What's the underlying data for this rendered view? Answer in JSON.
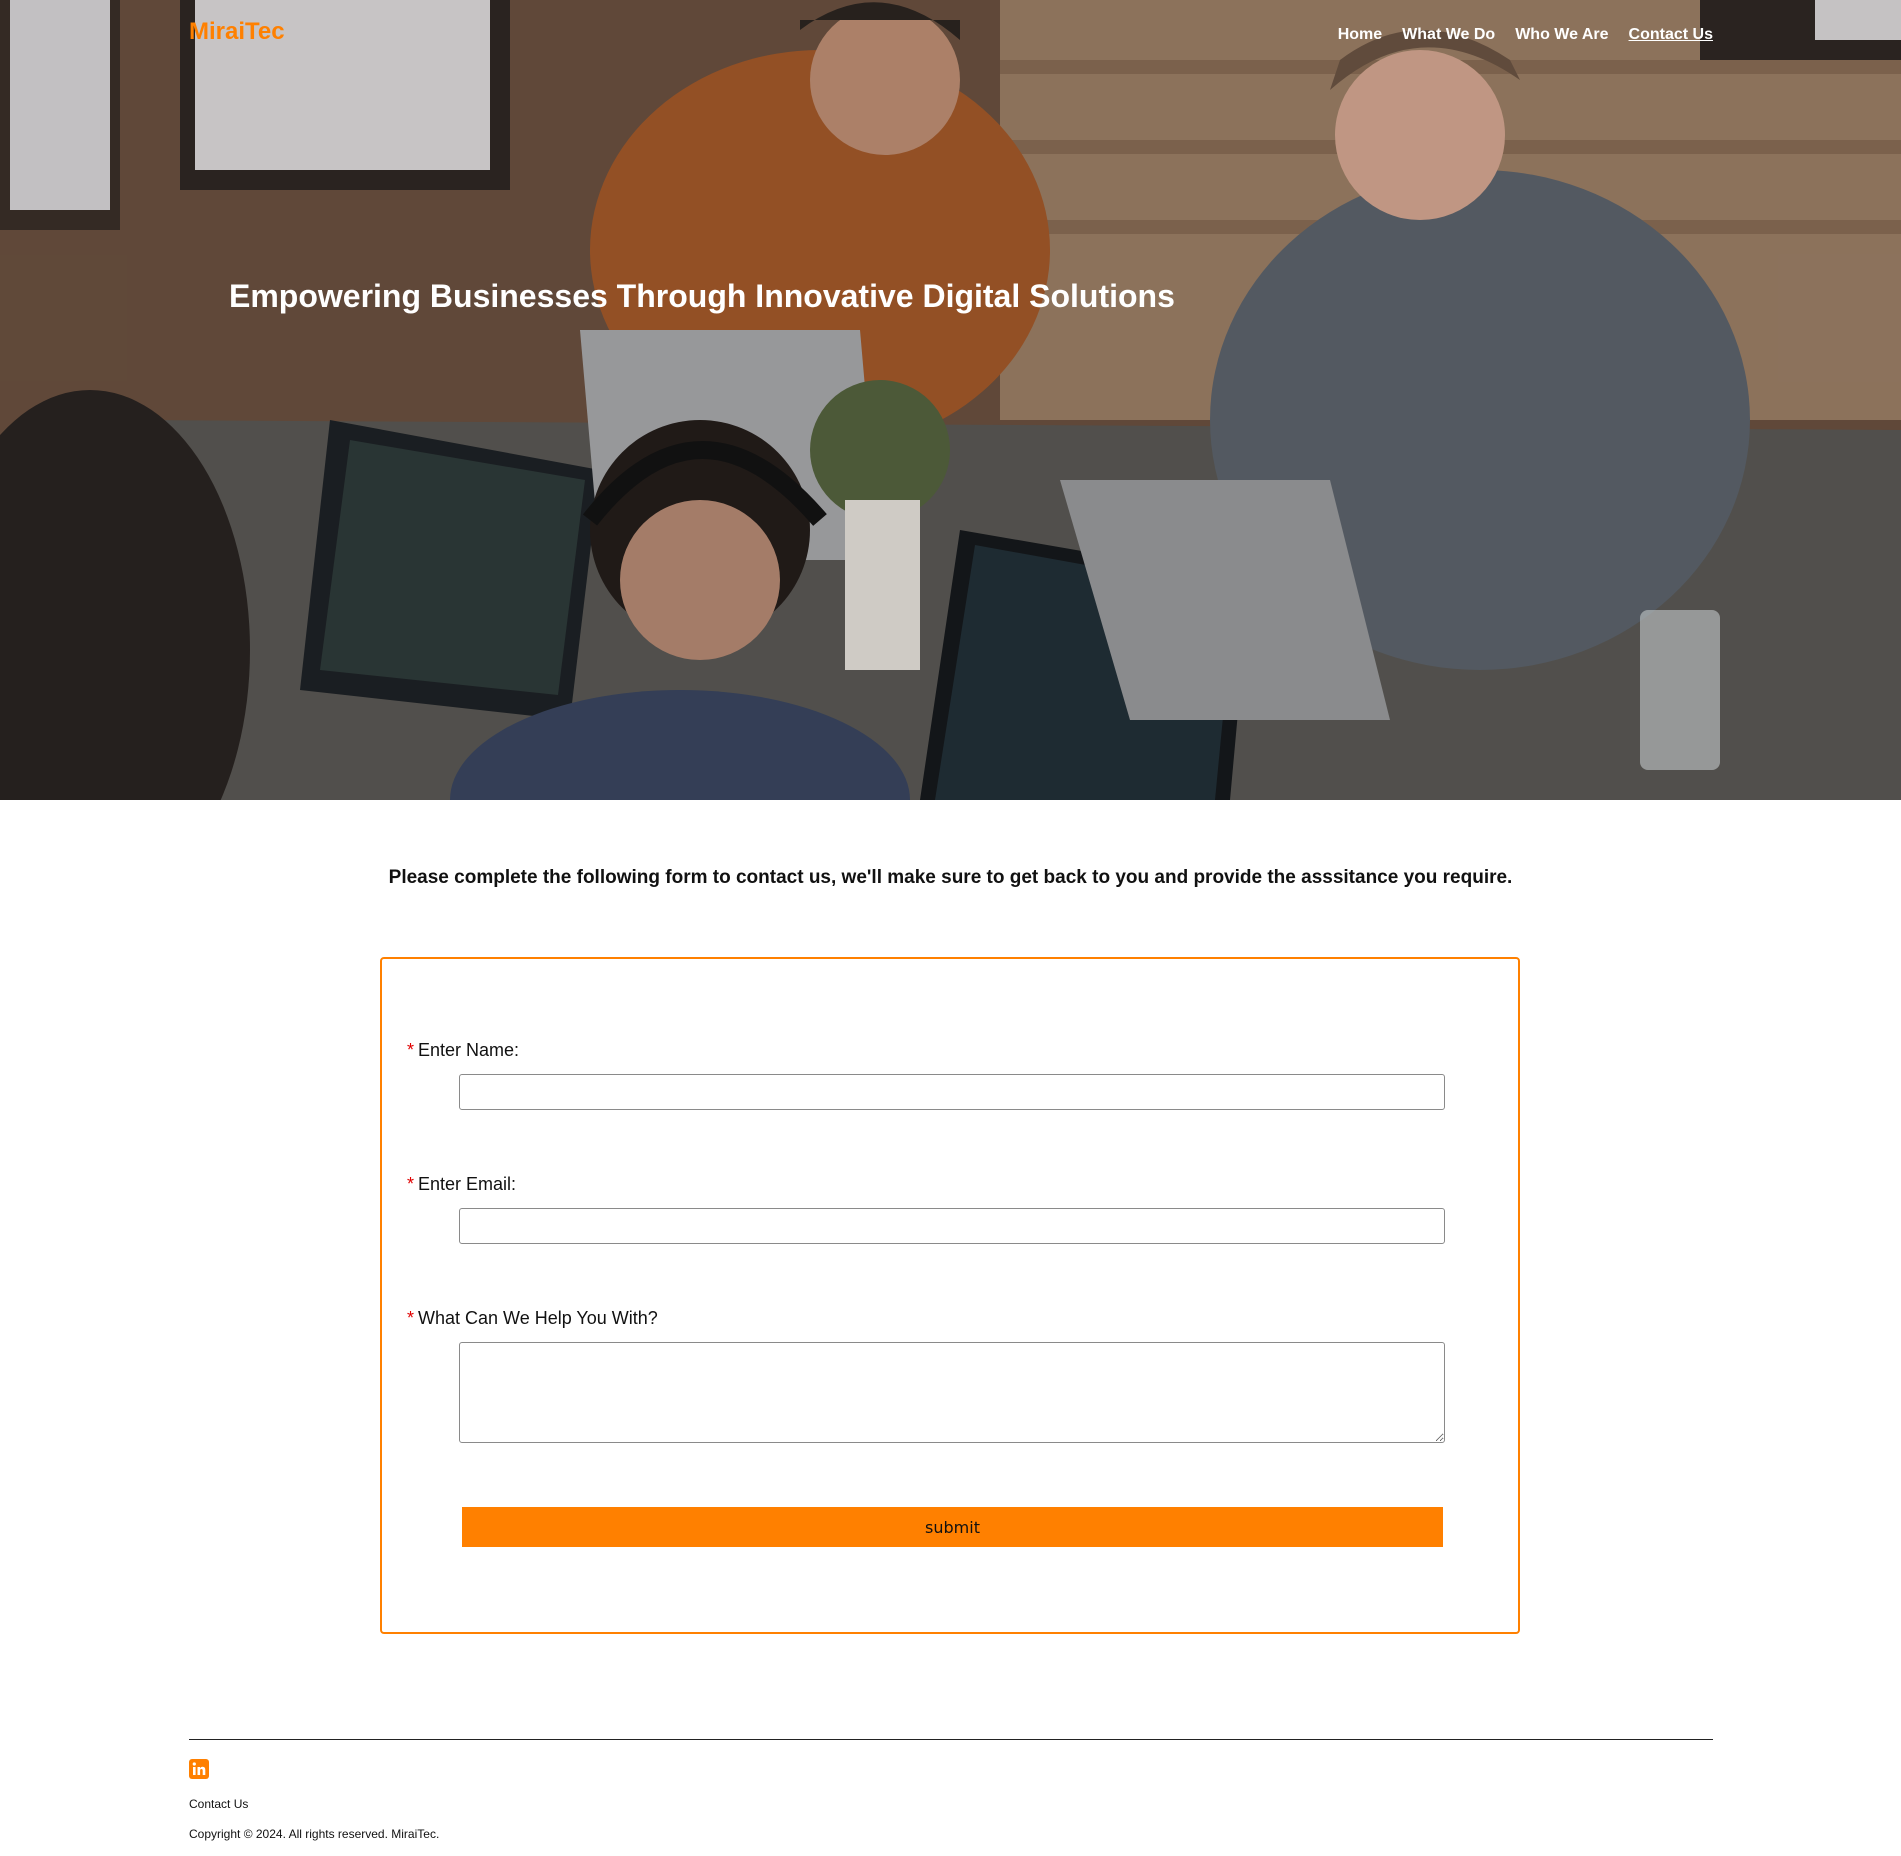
{
  "header": {
    "brand": "MiraiTec",
    "nav": [
      {
        "label": "Home"
      },
      {
        "label": "What We Do"
      },
      {
        "label": "Who We Are"
      },
      {
        "label": "Contact Us",
        "active": true
      }
    ]
  },
  "hero": {
    "title": "Empowering Businesses Through Innovative Digital Solutions",
    "image": "team working on laptops around a wooden table"
  },
  "intro": {
    "text": "Please complete the following form to contact us, we'll make sure to get back to you and provide the asssitance you require."
  },
  "form": {
    "required_mark": "*",
    "name": {
      "label": "Enter Name:",
      "value": ""
    },
    "email": {
      "label": "Enter Email:",
      "value": ""
    },
    "message": {
      "label": "What Can We Help You With?",
      "value": ""
    },
    "submit_label": "submit"
  },
  "footer": {
    "social_icon": "linkedin-icon",
    "link_label": "Contact Us",
    "copyright": "Copyright © 2024. All rights reserved. MiraiTec."
  },
  "colors": {
    "accent": "#ff8000",
    "required": "#e00000",
    "text": "#111111"
  }
}
